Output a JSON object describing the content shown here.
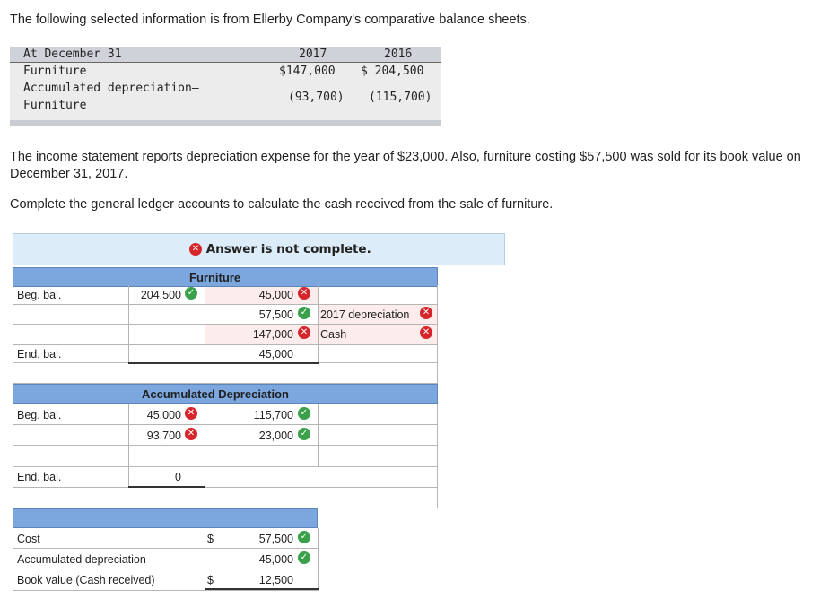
{
  "intro": "The following selected information is from Ellerby Company's comparative balance sheets.",
  "balance_sheet": {
    "header_label": "At December 31",
    "year_2017": "2017",
    "year_2016": "2016",
    "furniture_label": "Furniture",
    "furniture_2017": "$147,000",
    "furniture_2016": "$ 204,500",
    "accum_label_1": "Accumulated depreciation—",
    "accum_label_2": "Furniture",
    "accum_2017": "(93,700)",
    "accum_2016": "(115,700)"
  },
  "paragraph1": "The income statement reports depreciation expense for the year of $23,000. Also, furniture costing $57,500 was sold for its book value on December 31, 2017.",
  "paragraph2": "Complete the general ledger accounts to calculate the cash received from the sale of furniture.",
  "banner": "Answer is not complete.",
  "furniture_ledger": {
    "title": "Furniture",
    "beg_label": "Beg. bal.",
    "beg_debit": "204,500",
    "credit_1": "45,000",
    "credit_2": "57,500",
    "credit_2_label": "2017 depreciation",
    "credit_3": "147,000",
    "credit_3_label": "Cash",
    "end_label": "End. bal.",
    "end_credit": "45,000"
  },
  "accum_ledger": {
    "title": "Accumulated Depreciation",
    "beg_label": "Beg. bal.",
    "debit_1": "45,000",
    "debit_2": "93,700",
    "credit_1": "115,700",
    "credit_2": "23,000",
    "end_label": "End. bal.",
    "end_debit": "0"
  },
  "summary": {
    "cost_label": "Cost",
    "cost_dollar": "$",
    "cost_value": "57,500",
    "accum_label": "Accumulated depreciation",
    "accum_value": "45,000",
    "book_label": "Book value (Cash received)",
    "book_dollar": "$",
    "book_value": "12,500"
  },
  "colors": {
    "band": "#7ba7de",
    "banner_bg": "#dcecf8",
    "incorrect": "#d6262b",
    "correct": "#3aa14a",
    "incorrect_fill": "#fcecec"
  },
  "icons": {
    "incorrect": "✕",
    "correct": "✓"
  }
}
